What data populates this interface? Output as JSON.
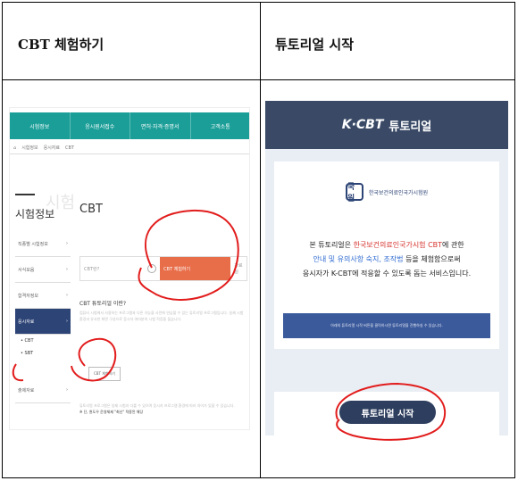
{
  "headers": {
    "left": "CBT 체험하기",
    "right": "튜토리얼 시작"
  },
  "left_shot": {
    "nav": [
      "시험정보",
      "응시원서접수",
      "면허·자격·증명서",
      "고객소통"
    ],
    "breadcrumb": [
      "⌂",
      "시험정보",
      "응시자료",
      "CBT"
    ],
    "sidebar_title": "시험정보",
    "sidebar_ghost": "시험",
    "sidebar_items": [
      {
        "label": "직종별 시험정보",
        "active": false
      },
      {
        "label": "서식모음",
        "active": false
      },
      {
        "label": "합격자정보",
        "active": false
      },
      {
        "label": "응시자료",
        "active": true
      }
    ],
    "sidebar_subs": [
      "• CBT",
      "• SBT"
    ],
    "sidebar_last": "출제자료",
    "main_title": "CBT",
    "box_label": "CBT란?",
    "box_orange": "CBT 체험하기",
    "box_tail": "자료실",
    "question": "CBT 튜토리얼 이란?",
    "desc": "컴퓨터 시험에서 사용하는 프로그램과 다른 기능을 사전에 연습할 수 있는 튜토리얼 프로그램입니다. 실제 시험 환경과 유사한 화면 구성으로 응시자 여러분의 시험 적응을 돕습니다.",
    "cbt_button": "CBT 체험하기",
    "bottom_text": "튜토리얼 프로그램은 실제 시험과 다를 수 있으며 응시자 프로그램 환경에 따라 차이가 있을 수 있습니다.",
    "bottom_dark": "※ 단, 윈도우 운영체제 \"최신\" 적용된 해당"
  },
  "right_shot": {
    "logo": "K·CBT",
    "logo_sub": "튜토리얼",
    "inst_logo": "국원",
    "inst_name": "한국보건의료인국가시험원",
    "desc_1a": "본 튜토리얼은 ",
    "desc_1b": "한국보건의료인국가시험 CBT",
    "desc_1c": "에 관한",
    "desc_2a": "안내 및 유의사항 숙지, 조작법",
    "desc_2b": " 등을 체험함으로써",
    "desc_3": "응시자가 K-CBT에 적응할 수 있도록 돕는 서비스입니다.",
    "bar_text": "아래의 튜토리얼 시작 버튼을 클릭하시면 튜토리얼을 진행하실 수 있습니다.",
    "start_button": "튜토리얼 시작",
    "colors": {
      "header": "#3a4a66",
      "button": "#2d3e5e",
      "red": "#d6332e",
      "blue": "#2e6ad1"
    }
  }
}
